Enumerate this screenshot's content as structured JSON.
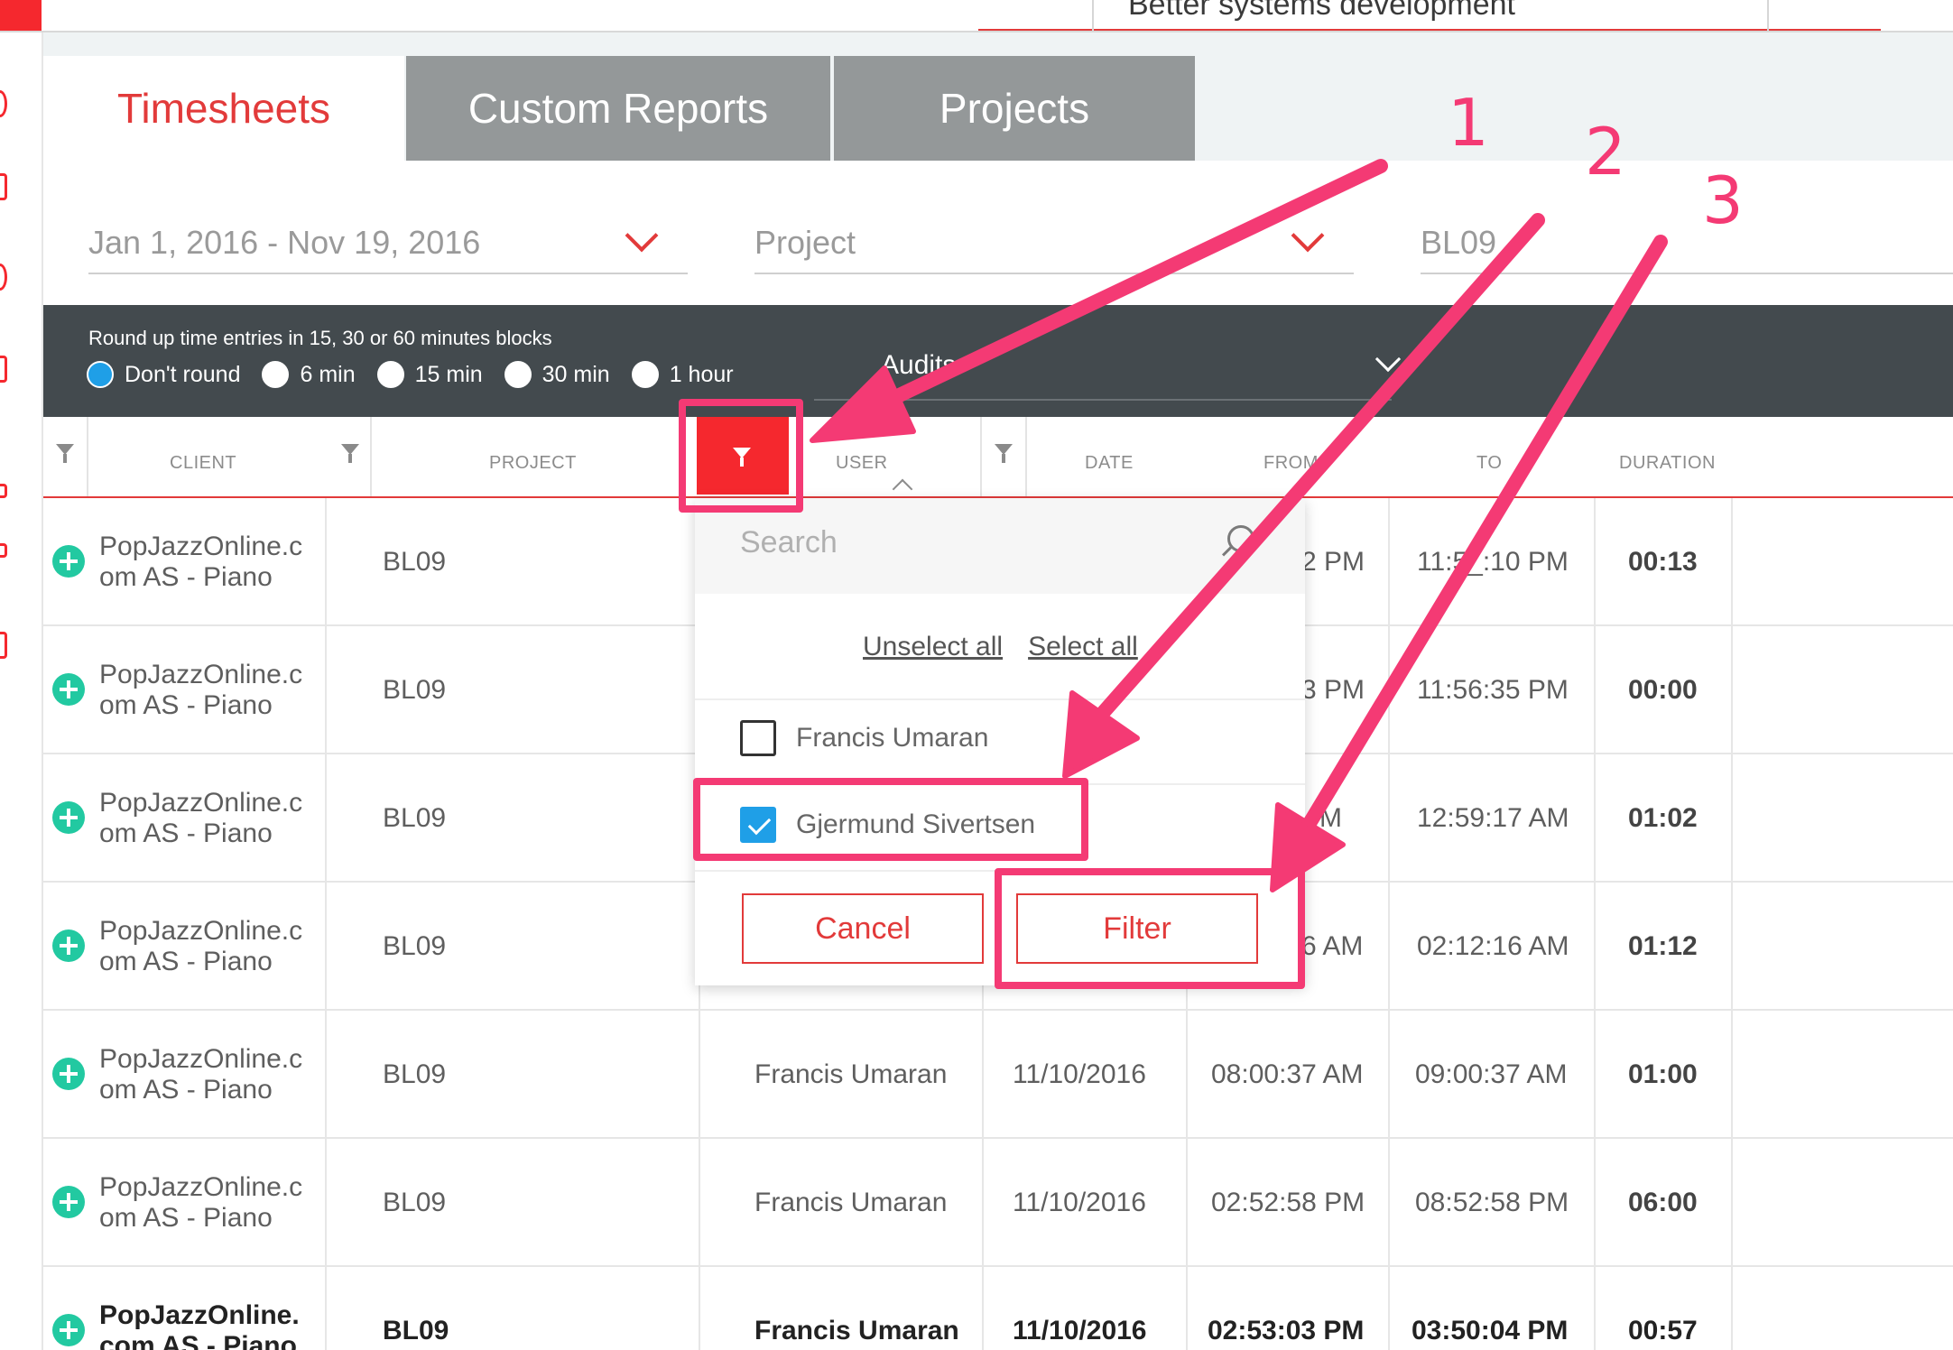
{
  "top": {
    "field_text": "Better systems development"
  },
  "tabs": [
    {
      "label": "Timesheets",
      "active": true
    },
    {
      "label": "Custom Reports",
      "active": false
    },
    {
      "label": "Projects",
      "active": false
    }
  ],
  "filters": {
    "date_range": "Jan 1, 2016 - Nov 19, 2016",
    "project_placeholder": "Project",
    "project_value": "BL09"
  },
  "rounding": {
    "title": "Round up time entries in 15, 30 or 60 minutes blocks",
    "options": [
      "Don't round",
      "6 min",
      "15 min",
      "30 min",
      "1 hour"
    ],
    "selected": "Don't round",
    "audits_label": "Audits"
  },
  "table": {
    "columns": [
      "CLIENT",
      "PROJECT",
      "USER",
      "DATE",
      "FROM",
      "TO",
      "DURATION"
    ],
    "rows": [
      {
        "client_l1": "PopJazzOnline.c",
        "client_l2": "om AS - Piano",
        "project": "BL09",
        "user": "",
        "date": "",
        "from": "2 PM",
        "to": "11:5_:10 PM",
        "duration": "00:13",
        "bold": false
      },
      {
        "client_l1": "PopJazzOnline.c",
        "client_l2": "om AS - Piano",
        "project": "BL09",
        "user": "",
        "date": "",
        "from": "3 PM",
        "to": "11:56:35 PM",
        "duration": "00:00",
        "bold": false
      },
      {
        "client_l1": "PopJazzOnline.c",
        "client_l2": "om AS - Piano",
        "project": "BL09",
        "user": "",
        "date": "",
        "from": "M",
        "to": "12:59:17 AM",
        "duration": "01:02",
        "bold": false
      },
      {
        "client_l1": "PopJazzOnline.c",
        "client_l2": "om AS - Piano",
        "project": "BL09",
        "user": "",
        "date": "",
        "from": "6 AM",
        "to": "02:12:16 AM",
        "duration": "01:12",
        "bold": false
      },
      {
        "client_l1": "PopJazzOnline.c",
        "client_l2": "om AS - Piano",
        "project": "BL09",
        "user": "Francis Umaran",
        "date": "11/10/2016",
        "from": "08:00:37 AM",
        "to": "09:00:37 AM",
        "duration": "01:00",
        "bold": false
      },
      {
        "client_l1": "PopJazzOnline.c",
        "client_l2": "om AS - Piano",
        "project": "BL09",
        "user": "Francis Umaran",
        "date": "11/10/2016",
        "from": "02:52:58 PM",
        "to": "08:52:58 PM",
        "duration": "06:00",
        "bold": false
      },
      {
        "client_l1": "PopJazzOnline.",
        "client_l2": "com AS - Piano",
        "project": "BL09",
        "user": "Francis Umaran",
        "date": "11/10/2016",
        "from": "02:53:03 PM",
        "to": "03:50:04 PM",
        "duration": "00:57",
        "bold": true
      }
    ]
  },
  "user_filter": {
    "search_placeholder": "Search",
    "unselect_all": "Unselect all",
    "select_all": "Select all",
    "options": [
      {
        "name": "Francis Umaran",
        "checked": false
      },
      {
        "name": "Gjermund Sivertsen",
        "checked": true
      }
    ],
    "cancel_label": "Cancel",
    "filter_label": "Filter"
  },
  "annotations": {
    "numbers": [
      "1",
      "2",
      "3"
    ],
    "color": "#f43a74"
  },
  "colors": {
    "accent": "#e23a3a",
    "filter_active": "#f5282e",
    "radio_selected": "#1f9fe7",
    "add_icon": "#22c9a1"
  }
}
